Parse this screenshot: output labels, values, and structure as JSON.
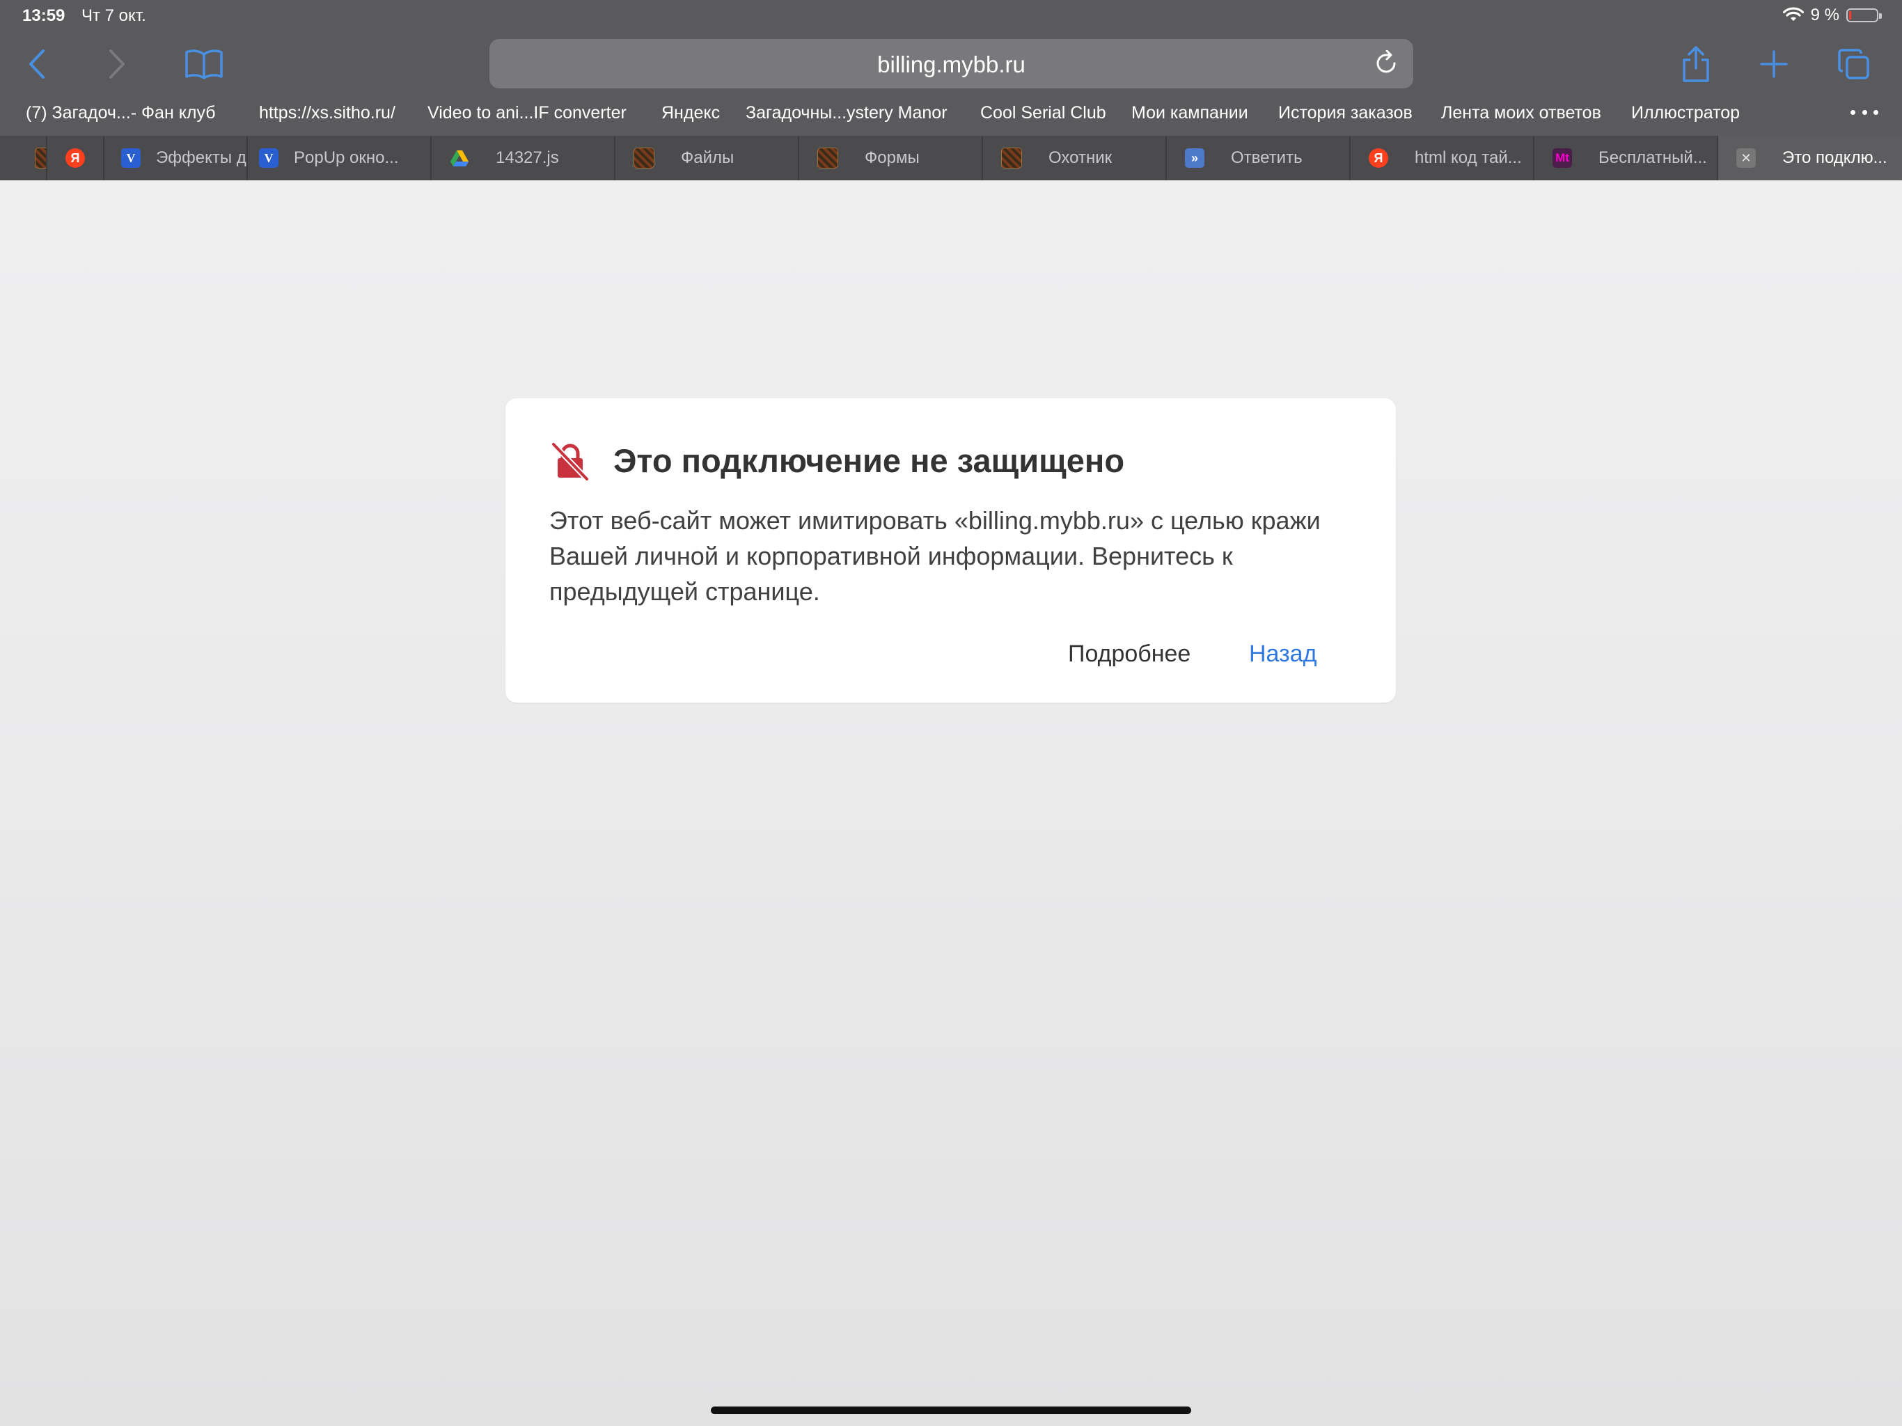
{
  "status_bar": {
    "time": "13:59",
    "date": "Чт 7 окт.",
    "battery_percent": "9 %",
    "battery_level": 0.09,
    "icons": [
      "wifi-icon",
      "battery-icon"
    ]
  },
  "toolbar": {
    "url": "billing.mybb.ru",
    "icons": [
      "back-icon",
      "forward-icon",
      "bookmarks-icon",
      "reload-icon",
      "share-icon",
      "new-tab-icon",
      "tabs-overview-icon"
    ],
    "accent_color": "#4a90e2"
  },
  "favorites": [
    {
      "label": "(7) Загадоч...- Фан клуб"
    },
    {
      "label": "https://xs.sitho.ru/"
    },
    {
      "label": "Video to ani...IF converter"
    },
    {
      "label": "Яндекс"
    },
    {
      "label": "Загадочны...ystery Manor"
    },
    {
      "label": "Cool Serial Club"
    },
    {
      "label": "Мои кампании"
    },
    {
      "label": "История заказов"
    },
    {
      "label": "Лента моих ответов"
    },
    {
      "label": "Иллюстратор"
    }
  ],
  "tabs": [
    {
      "label": "",
      "icon": "image-favicon"
    },
    {
      "label": "",
      "icon": "yandex-favicon",
      "glyph": "Я"
    },
    {
      "label": "Эффекты д",
      "icon": "v-favicon",
      "glyph": "V"
    },
    {
      "label": "PopUp окно...",
      "icon": "v-favicon",
      "glyph": "V"
    },
    {
      "label": "14327.js",
      "icon": "google-drive-favicon"
    },
    {
      "label": "Файлы",
      "icon": "image-favicon"
    },
    {
      "label": "Формы",
      "icon": "image-favicon"
    },
    {
      "label": "Охотник",
      "icon": "image-favicon"
    },
    {
      "label": "Ответить",
      "icon": "forum-favicon",
      "glyph": "»"
    },
    {
      "label": "html код тай...",
      "icon": "yandex-favicon",
      "glyph": "Я"
    },
    {
      "label": "Бесплатный...",
      "icon": "mt-favicon",
      "glyph": "Mt"
    },
    {
      "label": "Это подклю...",
      "icon": "close-favicon",
      "glyph": "✕",
      "active": true
    }
  ],
  "dialog": {
    "icon": "unsecure-lock-icon",
    "icon_color": "#c8323c",
    "title": "Это подключение не защищено",
    "body": "Этот веб-сайт может имитировать «billing.mybb.ru» с целью кражи Вашей личной и корпоративной информации. Вернитесь к предыдущей странице.",
    "details_label": "Подробнее",
    "back_label": "Назад",
    "link_color": "#2f78e0"
  }
}
